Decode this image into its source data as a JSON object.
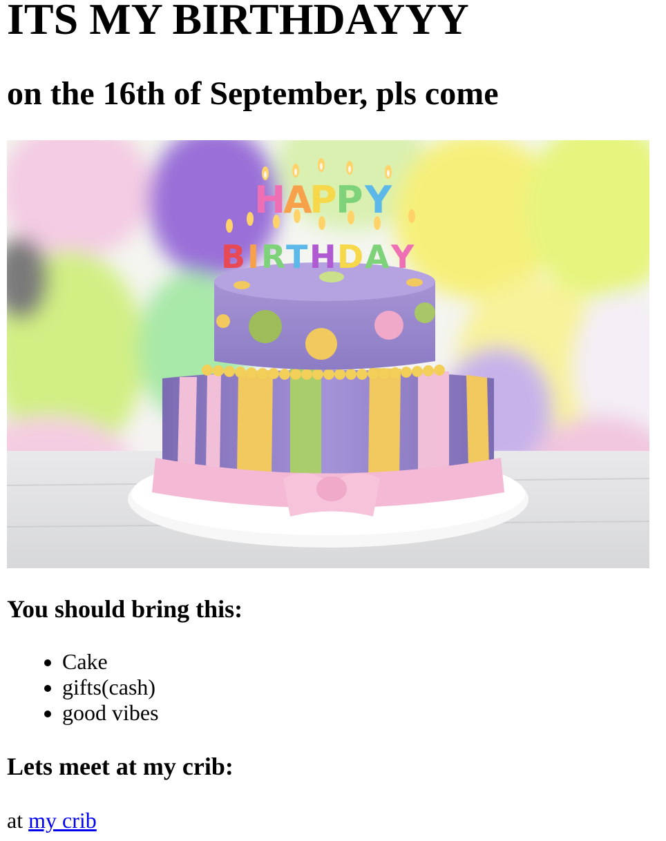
{
  "page": {
    "title": "ITS MY BIRTHDAYYY",
    "subtitle": "on the 16th of September, pls come"
  },
  "hero_image": {
    "icon": "birthday-cake-photo",
    "candle_text_top": "HAPPY",
    "candle_text_bottom": "BIRTHDAY"
  },
  "bring_section": {
    "heading": "You should bring this:",
    "items": [
      "Cake",
      "gifts(cash)",
      "good vibes"
    ]
  },
  "meet_section": {
    "heading": "Lets meet at my crib:",
    "prefix": "at",
    "link_text": "my crib"
  },
  "colors": {
    "link": "#0000ee",
    "text": "#000000"
  }
}
